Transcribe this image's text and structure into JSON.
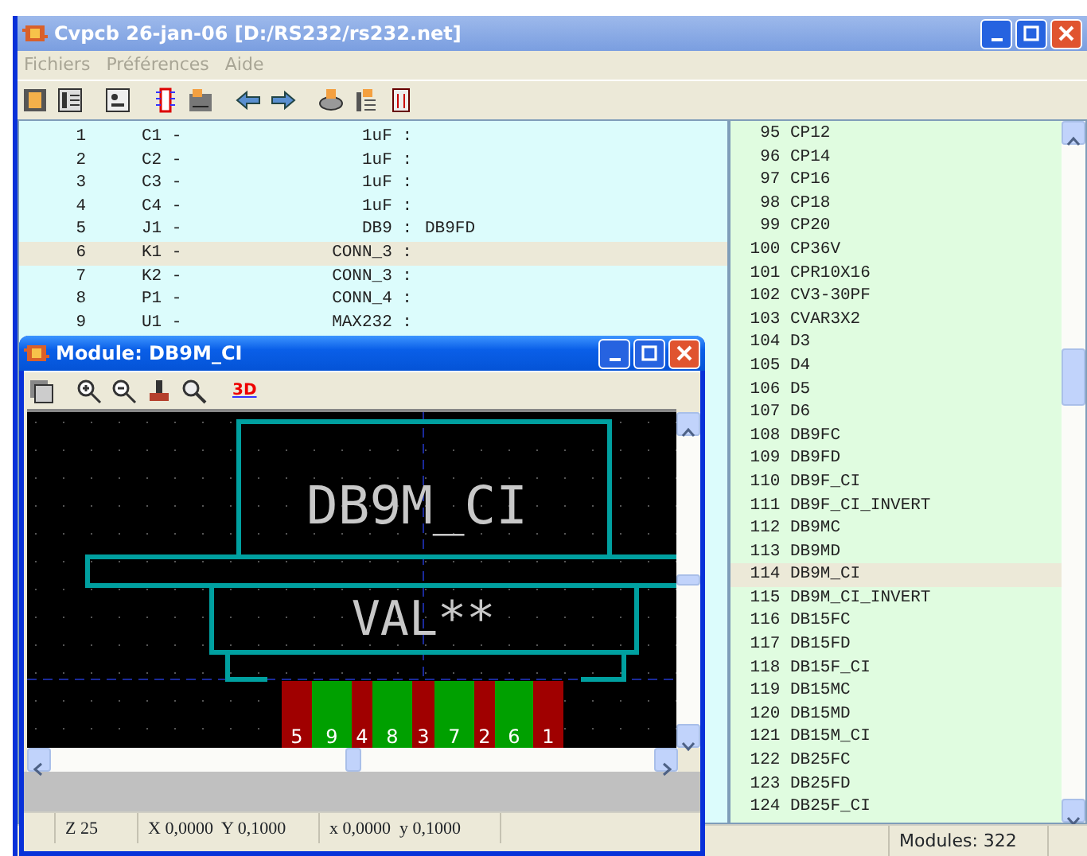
{
  "window": {
    "title": "Cvpcb 26-jan-06 [D:/RS232/rs232.net]"
  },
  "menu": [
    "Fichiers",
    "Préférences",
    "Aide"
  ],
  "components": [
    {
      "number": "1",
      "reference": "C1 -",
      "value": "1uF :",
      "selected": false
    },
    {
      "number": "2",
      "reference": "C2 -",
      "value": "1uF :",
      "selected": false
    },
    {
      "number": "3",
      "reference": "C3 -",
      "value": "1uF :",
      "selected": false
    },
    {
      "number": "4",
      "reference": "C4 -",
      "value": "1uF :",
      "selected": false
    },
    {
      "number": "5",
      "reference": "J1 -",
      "value": "DB9 :",
      "footprint": "DB9FD",
      "selected": false
    },
    {
      "number": "6",
      "reference": "K1 -",
      "value": "CONN_3 :",
      "selected": true
    },
    {
      "number": "7",
      "reference": "K2 -",
      "value": "CONN_3 :",
      "selected": false
    },
    {
      "number": "8",
      "reference": "P1 -",
      "value": "CONN_4 :",
      "selected": false
    },
    {
      "number": "9",
      "reference": "U1 -",
      "value": "MAX232 :",
      "selected": false
    }
  ],
  "modules": [
    {
      "number": "95",
      "name": "CP12",
      "selected": false
    },
    {
      "number": "96",
      "name": "CP14",
      "selected": false
    },
    {
      "number": "97",
      "name": "CP16",
      "selected": false
    },
    {
      "number": "98",
      "name": "CP18",
      "selected": false
    },
    {
      "number": "99",
      "name": "CP20",
      "selected": false
    },
    {
      "number": "100",
      "name": "CP36V",
      "selected": false
    },
    {
      "number": "101",
      "name": "CPR10X16",
      "selected": false
    },
    {
      "number": "102",
      "name": "CV3-30PF",
      "selected": false
    },
    {
      "number": "103",
      "name": "CVAR3X2",
      "selected": false
    },
    {
      "number": "104",
      "name": "D3",
      "selected": false
    },
    {
      "number": "105",
      "name": "D4",
      "selected": false
    },
    {
      "number": "106",
      "name": "D5",
      "selected": false
    },
    {
      "number": "107",
      "name": "D6",
      "selected": false
    },
    {
      "number": "108",
      "name": "DB9FC",
      "selected": false
    },
    {
      "number": "109",
      "name": "DB9FD",
      "selected": false
    },
    {
      "number": "110",
      "name": "DB9F_CI",
      "selected": false
    },
    {
      "number": "111",
      "name": "DB9F_CI_INVERT",
      "selected": false
    },
    {
      "number": "112",
      "name": "DB9MC",
      "selected": false
    },
    {
      "number": "113",
      "name": "DB9MD",
      "selected": false
    },
    {
      "number": "114",
      "name": "DB9M_CI",
      "selected": true
    },
    {
      "number": "115",
      "name": "DB9M_CI_INVERT",
      "selected": false
    },
    {
      "number": "116",
      "name": "DB15FC",
      "selected": false
    },
    {
      "number": "117",
      "name": "DB15FD",
      "selected": false
    },
    {
      "number": "118",
      "name": "DB15F_CI",
      "selected": false
    },
    {
      "number": "119",
      "name": "DB15MC",
      "selected": false
    },
    {
      "number": "120",
      "name": "DB15MD",
      "selected": false
    },
    {
      "number": "121",
      "name": "DB15M_CI",
      "selected": false
    },
    {
      "number": "122",
      "name": "DB25FC",
      "selected": false
    },
    {
      "number": "123",
      "name": "DB25FD",
      "selected": false
    },
    {
      "number": "124",
      "name": "DB25F_CI",
      "selected": false
    }
  ],
  "status_bar": {
    "modules": "Modules: 322"
  },
  "module_window": {
    "title": "Module: DB9M_CI",
    "toolbar_3d": "3D",
    "footprint": {
      "reference": "DB9M_CI",
      "value": "VAL**",
      "pads": [
        {
          "label": "5",
          "color": "#a00000"
        },
        {
          "label": "9",
          "color": "#00a000"
        },
        {
          "label": "4",
          "color": "#a00000"
        },
        {
          "label": "8",
          "color": "#00a000"
        },
        {
          "label": "3",
          "color": "#a00000"
        },
        {
          "label": "7",
          "color": "#00a000"
        },
        {
          "label": "2",
          "color": "#a00000"
        },
        {
          "label": "6",
          "color": "#00a000"
        },
        {
          "label": "1",
          "color": "#a00000"
        }
      ]
    },
    "status_bar": [
      "Z 25",
      "X 0,0000  Y 0,1000",
      "x 0,0000  y 0,1000"
    ]
  }
}
